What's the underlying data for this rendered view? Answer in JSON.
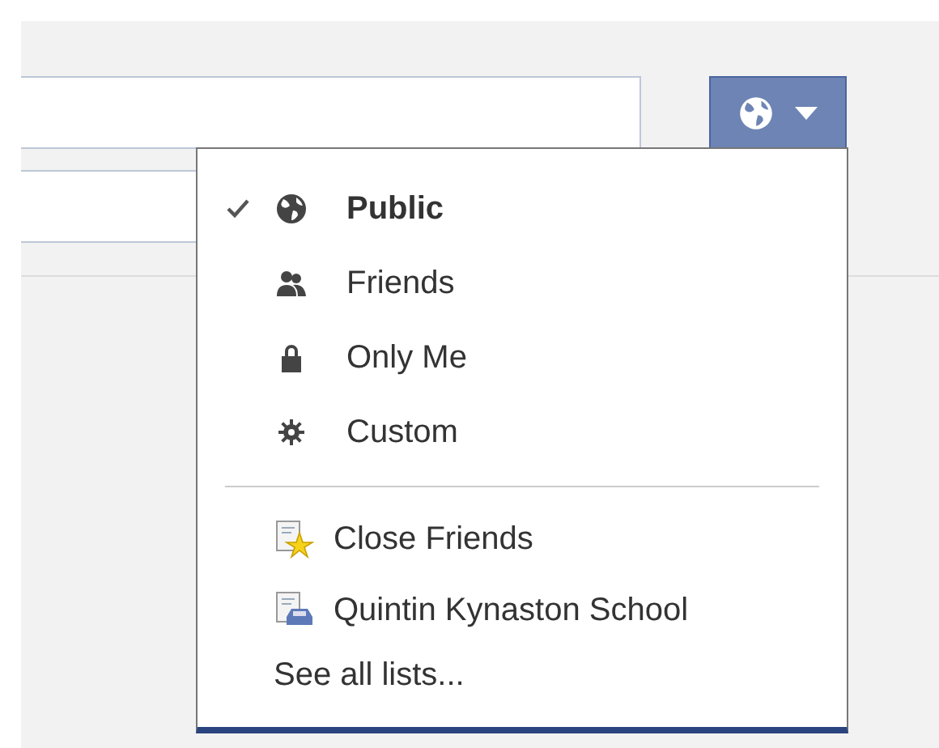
{
  "privacy_button": {
    "expanded": true
  },
  "menu": {
    "audiences": [
      {
        "label": "Public",
        "selected": true
      },
      {
        "label": "Friends",
        "selected": false
      },
      {
        "label": "Only Me",
        "selected": false
      },
      {
        "label": "Custom",
        "selected": false
      }
    ],
    "lists": [
      {
        "label": "Close Friends",
        "selected": false
      },
      {
        "label": "Quintin Kynaston School",
        "selected": false
      }
    ],
    "see_all": "See all lists..."
  }
}
